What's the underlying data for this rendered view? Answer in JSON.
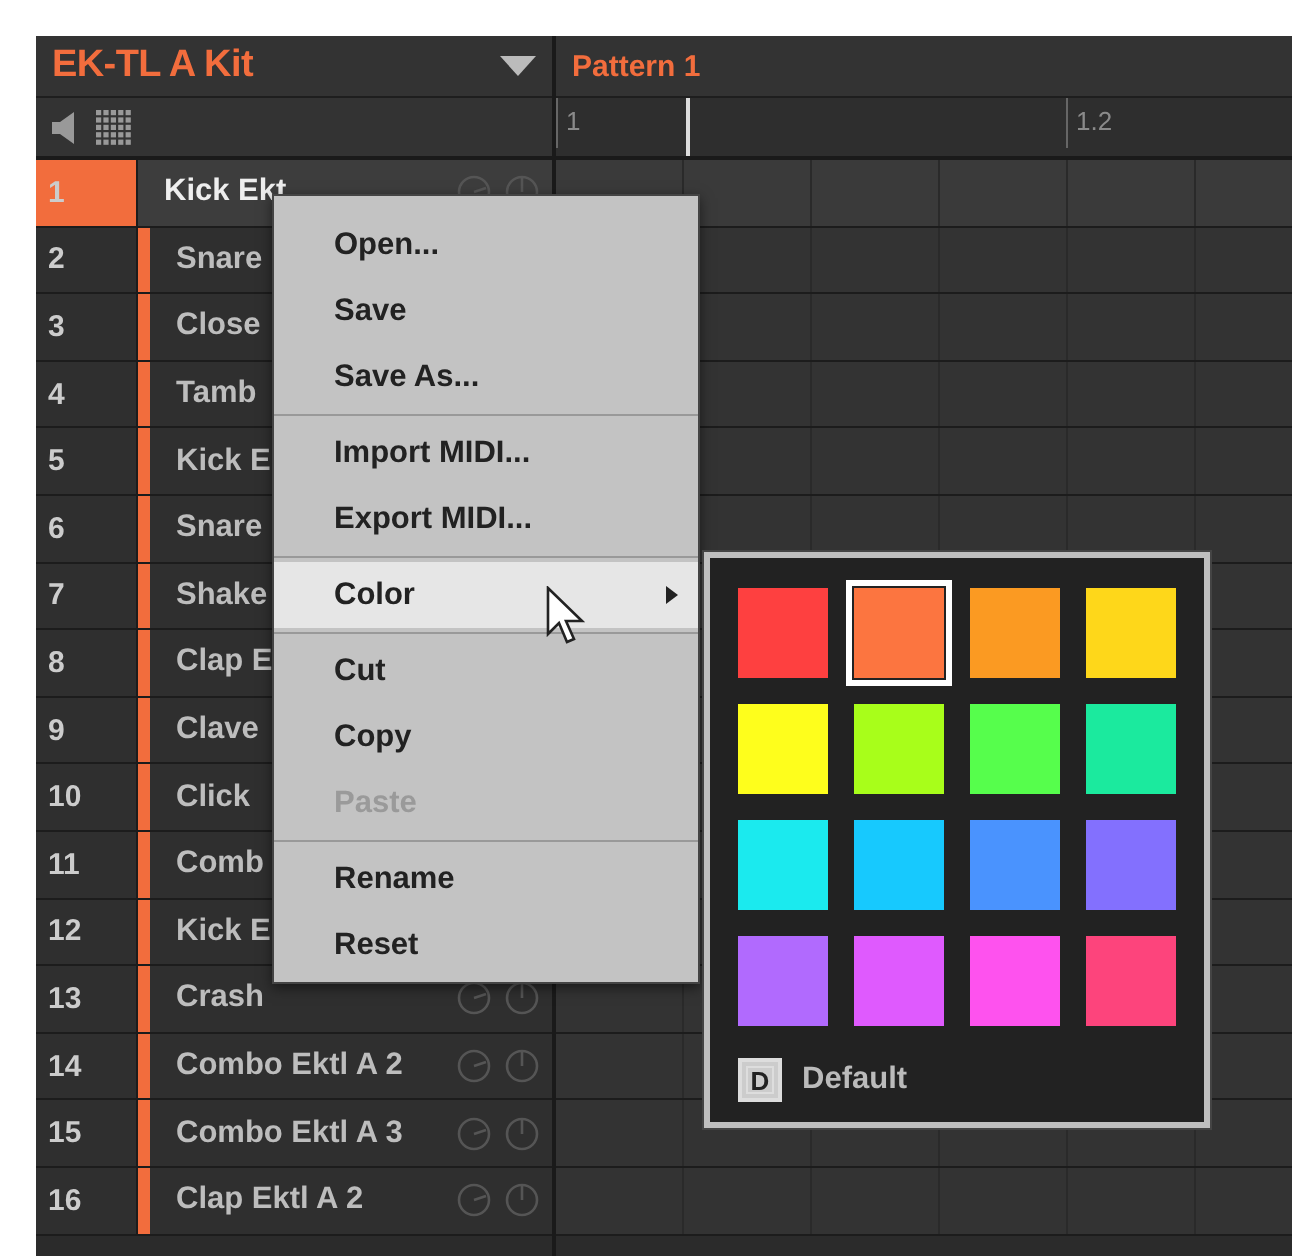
{
  "kit": {
    "title": "EK-TL A Kit"
  },
  "pattern": {
    "title": "Pattern 1",
    "ruler": [
      "1",
      "1.2"
    ]
  },
  "sounds": [
    {
      "number": "1",
      "name": "Kick Ekt",
      "color": "#f26d3d",
      "selected": true,
      "controls": true
    },
    {
      "number": "2",
      "name": "Snare",
      "color": "#f26d3d",
      "selected": false
    },
    {
      "number": "3",
      "name": "Close",
      "color": "#f26d3d",
      "selected": false
    },
    {
      "number": "4",
      "name": "Tamb",
      "color": "#f26d3d",
      "selected": false
    },
    {
      "number": "5",
      "name": "Kick E",
      "color": "#f26d3d",
      "selected": false
    },
    {
      "number": "6",
      "name": "Snare",
      "color": "#f26d3d",
      "selected": false
    },
    {
      "number": "7",
      "name": "Shake",
      "color": "#f26d3d",
      "selected": false
    },
    {
      "number": "8",
      "name": "Clap E",
      "color": "#f26d3d",
      "selected": false
    },
    {
      "number": "9",
      "name": "Clave",
      "color": "#f26d3d",
      "selected": false
    },
    {
      "number": "10",
      "name": "Click",
      "color": "#f26d3d",
      "selected": false
    },
    {
      "number": "11",
      "name": "Comb",
      "color": "#f26d3d",
      "selected": false
    },
    {
      "number": "12",
      "name": "Kick E",
      "color": "#f26d3d",
      "selected": false
    },
    {
      "number": "13",
      "name": "Crash",
      "color": "#f26d3d",
      "selected": false,
      "controls": true
    },
    {
      "number": "14",
      "name": "Combo Ektl A 2",
      "color": "#f26d3d",
      "selected": false,
      "controls": true
    },
    {
      "number": "15",
      "name": "Combo Ektl A 3",
      "color": "#f26d3d",
      "selected": false,
      "controls": true
    },
    {
      "number": "16",
      "name": "Clap Ektl A 2",
      "color": "#f26d3d",
      "selected": false,
      "controls": true
    }
  ],
  "context_menu": [
    {
      "kind": "item",
      "label": "Open...",
      "disabled": false,
      "selected": false
    },
    {
      "kind": "item",
      "label": "Save",
      "disabled": false,
      "selected": false
    },
    {
      "kind": "item",
      "label": "Save As...",
      "disabled": false,
      "selected": false
    },
    {
      "kind": "separator"
    },
    {
      "kind": "item",
      "label": "Import MIDI...",
      "disabled": false,
      "selected": false
    },
    {
      "kind": "item",
      "label": "Export MIDI...",
      "disabled": false,
      "selected": false
    },
    {
      "kind": "separator"
    },
    {
      "kind": "submenu",
      "label": "Color",
      "disabled": false,
      "selected": true
    },
    {
      "kind": "separator"
    },
    {
      "kind": "item",
      "label": "Cut",
      "disabled": false,
      "selected": false
    },
    {
      "kind": "item",
      "label": "Copy",
      "disabled": false,
      "selected": false
    },
    {
      "kind": "item",
      "label": "Paste",
      "disabled": true,
      "selected": false
    },
    {
      "kind": "separator"
    },
    {
      "kind": "item",
      "label": "Rename",
      "disabled": false,
      "selected": false
    },
    {
      "kind": "item",
      "label": "Reset",
      "disabled": false,
      "selected": false
    }
  ],
  "color_picker": {
    "swatches": [
      {
        "color": "#fe4040",
        "selected": false
      },
      {
        "color": "#fc7540",
        "selected": true
      },
      {
        "color": "#fb9a22",
        "selected": false
      },
      {
        "color": "#fed71a",
        "selected": false
      },
      {
        "color": "#fefe1c",
        "selected": false
      },
      {
        "color": "#a8fe1a",
        "selected": false
      },
      {
        "color": "#56fe4c",
        "selected": false
      },
      {
        "color": "#1bea9e",
        "selected": false
      },
      {
        "color": "#1beaee",
        "selected": false
      },
      {
        "color": "#17c9fe",
        "selected": false
      },
      {
        "color": "#4a93fe",
        "selected": false
      },
      {
        "color": "#8370fe",
        "selected": false
      },
      {
        "color": "#b16afe",
        "selected": false
      },
      {
        "color": "#df5afe",
        "selected": false
      },
      {
        "color": "#fe52ee",
        "selected": false
      },
      {
        "color": "#fd447c",
        "selected": false
      }
    ],
    "default": {
      "key": "D",
      "label": "Default"
    }
  }
}
